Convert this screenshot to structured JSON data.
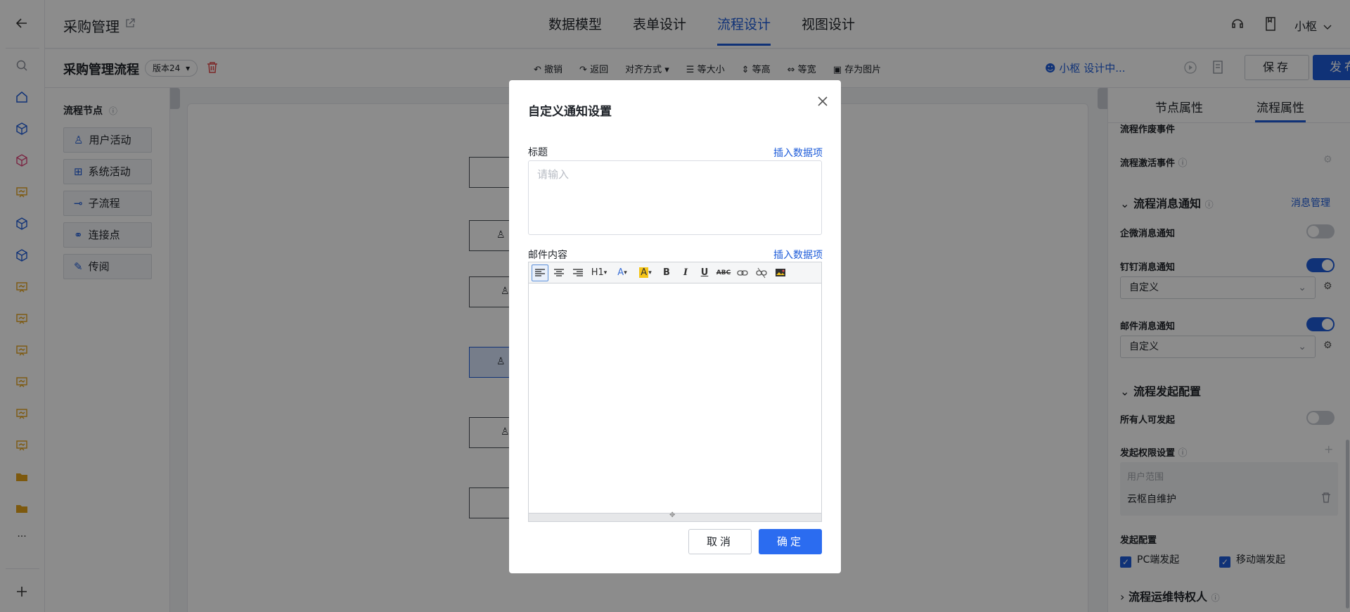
{
  "header": {
    "app_title": "采购管理",
    "nav_tabs": [
      {
        "label": "数据模型",
        "active": false
      },
      {
        "label": "表单设计",
        "active": false
      },
      {
        "label": "流程设计",
        "active": true
      },
      {
        "label": "视图设计",
        "active": false
      }
    ],
    "user": "小枢"
  },
  "toolbar": {
    "flow_title": "采购管理流程",
    "version": "版本24",
    "undo": "撤销",
    "redo": "返回",
    "align": "对齐方式",
    "same_size": "等大小",
    "same_height": "等高",
    "same_width": "等宽",
    "save_image": "存为图片",
    "status": "小枢 设计中...",
    "save": "保存",
    "publish": "发布"
  },
  "left_panel": {
    "title": "流程节点",
    "nodes": [
      "用户活动",
      "系统活动",
      "子流程",
      "连接点",
      "传阅"
    ]
  },
  "right_panel": {
    "tabs": [
      {
        "label": "节点属性",
        "active": false
      },
      {
        "label": "流程属性",
        "active": true
      }
    ],
    "void_event": "流程作废事件",
    "activate_event": "流程激活事件",
    "notify_section": "流程消息通知",
    "notify_manage": "消息管理",
    "wecom_notify": "企微消息通知",
    "dingtalk_notify": "钉钉消息通知",
    "dingtalk_select": "自定义",
    "mail_notify": "邮件消息通知",
    "mail_select": "自定义",
    "launch_section": "流程发起配置",
    "anyone_launch": "所有人可发起",
    "permission": "发起权限设置",
    "user_scope_label": "用户范围",
    "user_scope_value": "云枢自维护",
    "launch_config": "发起配置",
    "pc_launch": "PC端发起",
    "mobile_launch": "移动端发起",
    "ops_section": "流程运维特权人"
  },
  "modal": {
    "title": "自定义通知设置",
    "title_label": "标题",
    "insert_data_1": "插入数据项",
    "title_placeholder": "请输入",
    "content_label": "邮件内容",
    "insert_data_2": "插入数据项",
    "cancel": "取消",
    "confirm": "确定"
  },
  "colors": {
    "primary": "#1e5cd9",
    "mask": "rgba(0,0,0,0.45)",
    "danger": "#e34d4d"
  }
}
